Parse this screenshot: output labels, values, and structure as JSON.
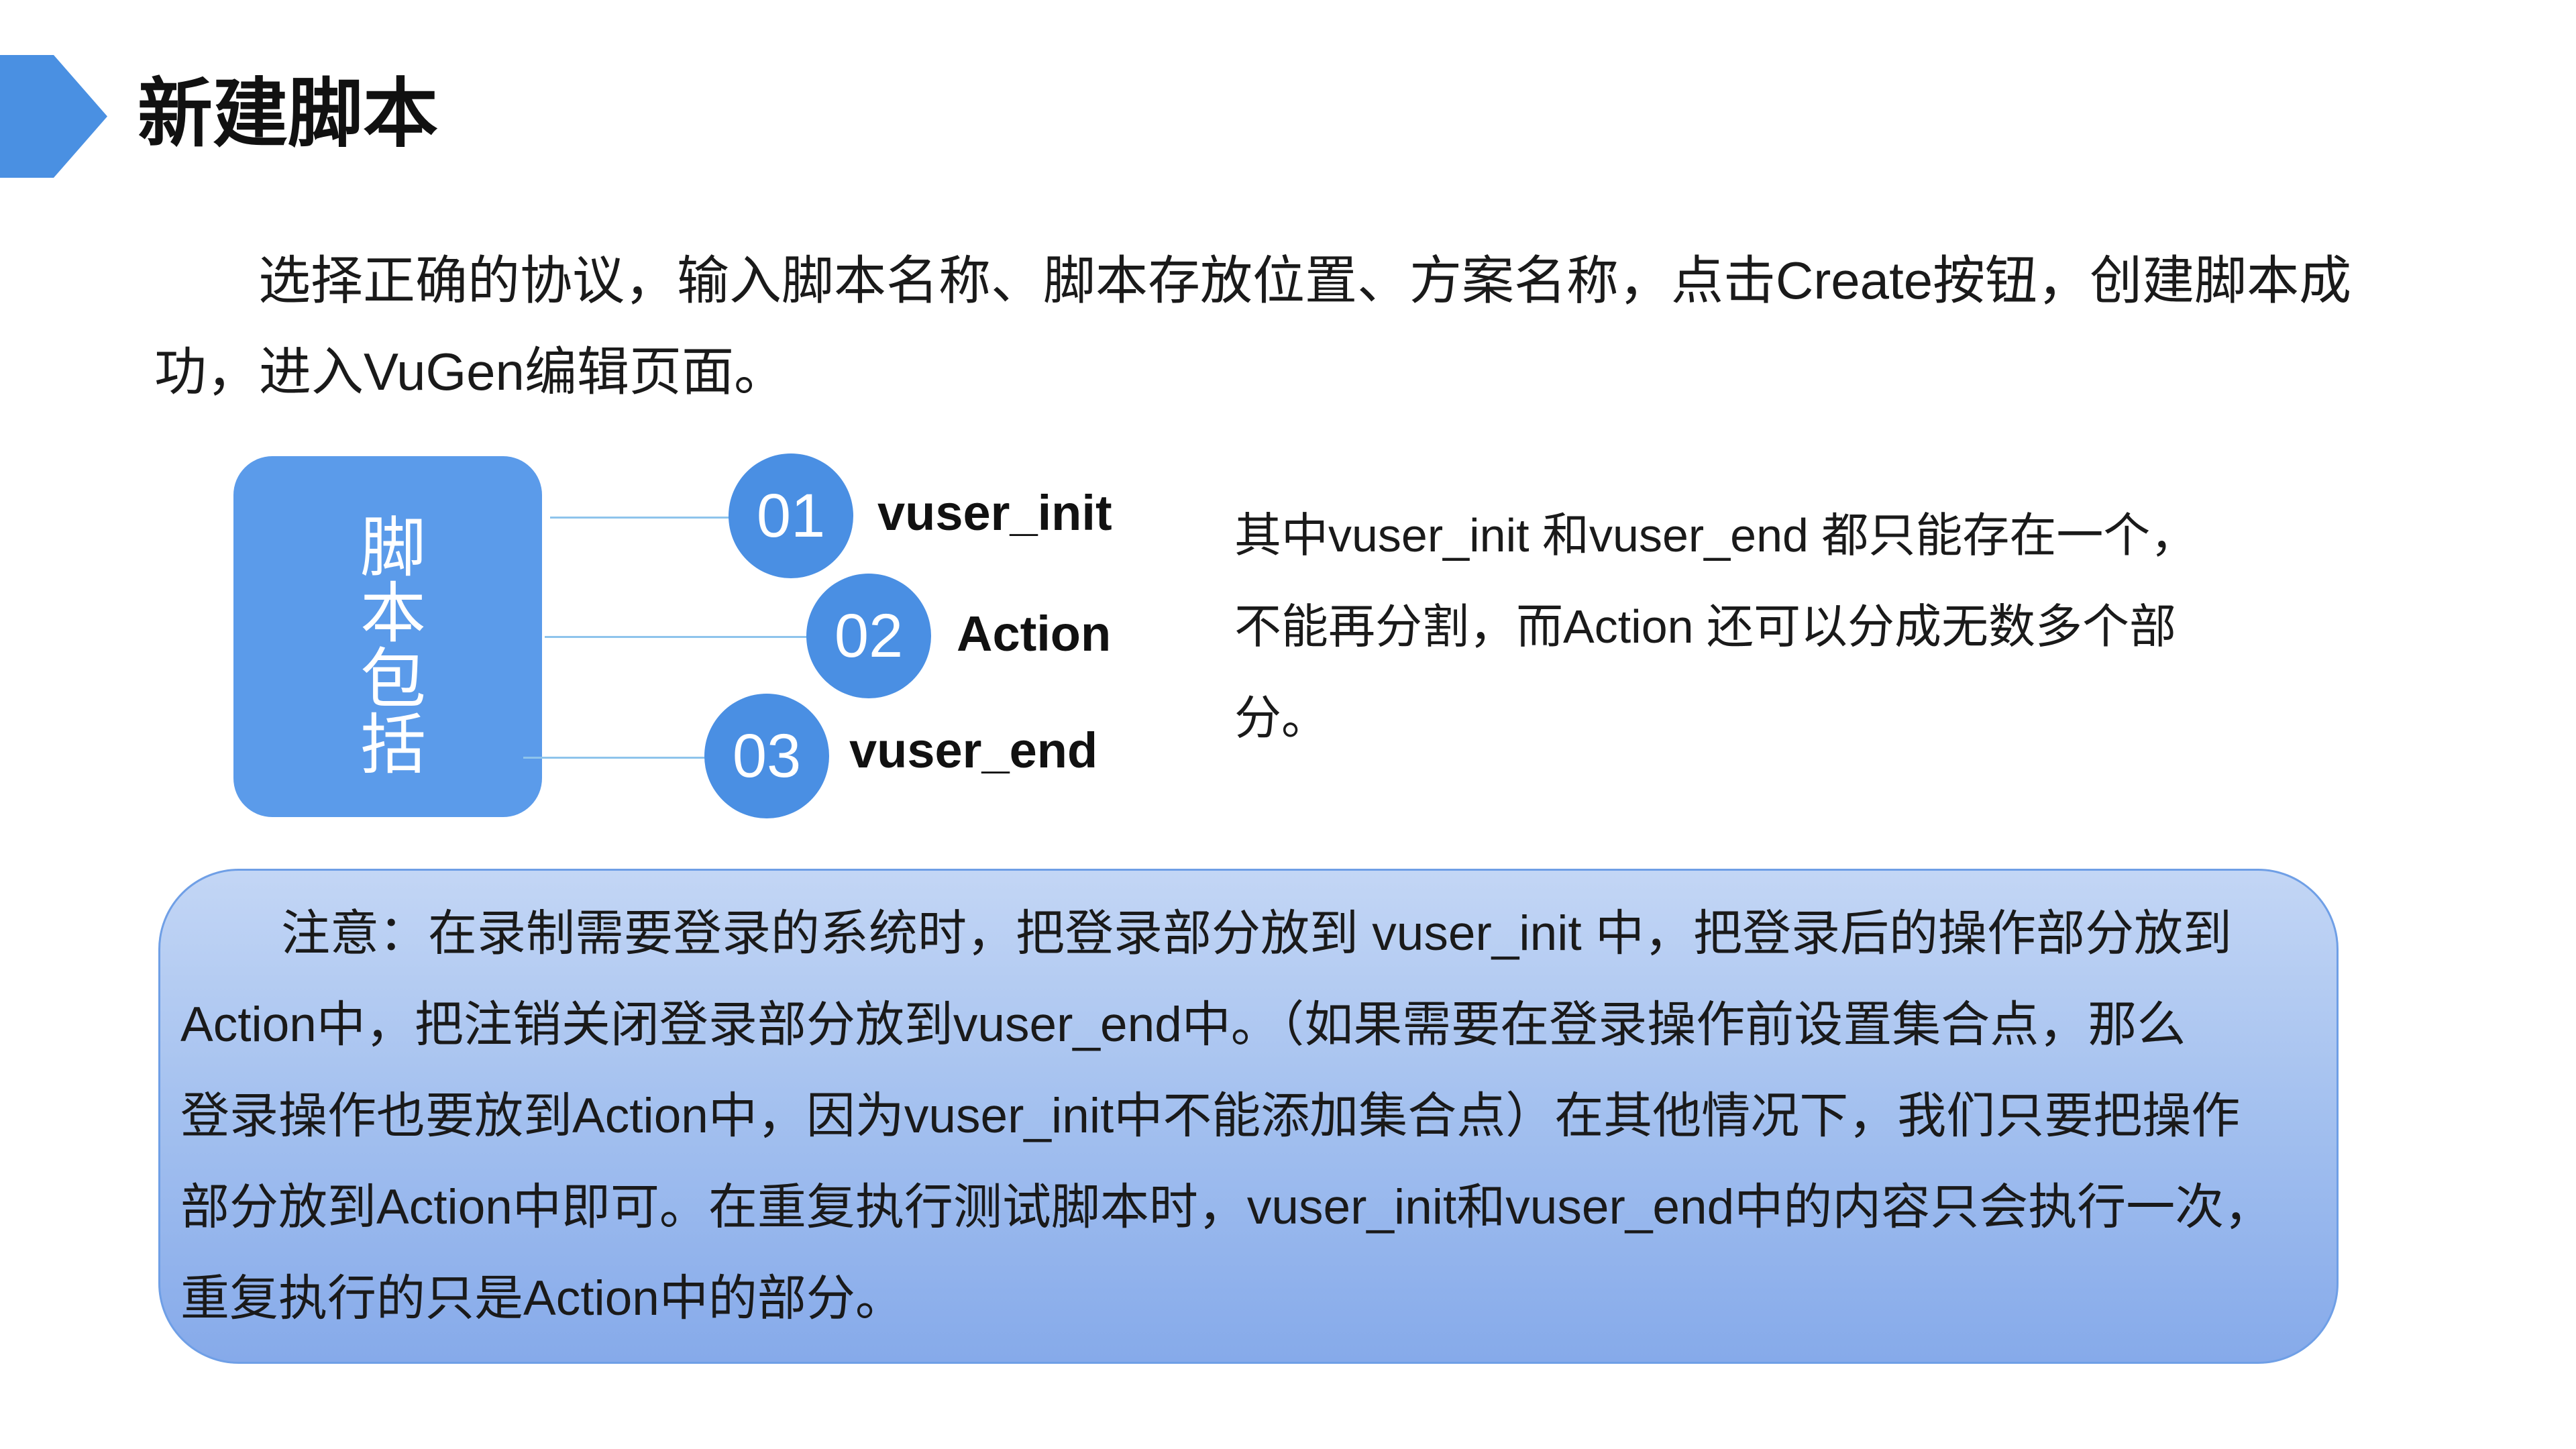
{
  "header": {
    "title": "新建脚本"
  },
  "intro": {
    "line1": "选择正确的协议，输入脚本名称、脚本存放位置、方案名称，点击Create按钮，创建脚本成",
    "line2": "功，进入VuGen编辑页面。"
  },
  "parts": {
    "label": "脚本包括",
    "items": [
      {
        "number": "01",
        "name": "vuser_init"
      },
      {
        "number": "02",
        "name": "Action"
      },
      {
        "number": "03",
        "name": "vuser_end"
      }
    ]
  },
  "side_note": {
    "lines": [
      "其中vuser_init 和vuser_end 都只能存在一个，",
      "不能再分割，而Action 还可以分成无数多个部",
      "分。"
    ]
  },
  "note": {
    "lines": [
      "注意：在录制需要登录的系统时，把登录部分放到 vuser_init 中，把登录后的操作部分放到",
      "Action中，把注销关闭登录部分放到vuser_end中。（如果需要在登录操作前设置集合点，那么",
      "登录操作也要放到Action中，因为vuser_init中不能添加集合点）在其他情况下，我们只要把操作",
      "部分放到Action中即可。在重复执行测试脚本时，vuser_init和vuser_end中的内容只会执行一次，",
      "重复执行的只是Action中的部分。"
    ]
  },
  "colors": {
    "accent": "#4a90e2",
    "box": "#5b9bea",
    "circle": "#4a8fe3",
    "connector": "#8ec4ec",
    "note_bg": "#a3c0ef"
  }
}
